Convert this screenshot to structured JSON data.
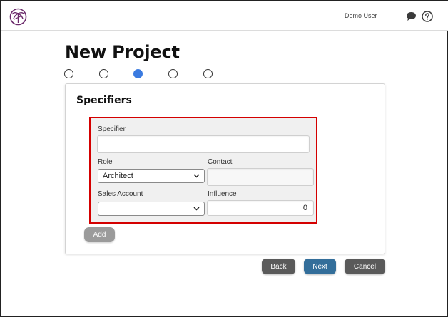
{
  "header": {
    "user_name": "Demo User",
    "icons": [
      "palm-logo-icon",
      "chat-icon",
      "help-icon"
    ]
  },
  "page": {
    "title": "New Project",
    "steps": [
      {
        "state": "incomplete"
      },
      {
        "state": "incomplete"
      },
      {
        "state": "current"
      },
      {
        "state": "incomplete"
      },
      {
        "state": "incomplete"
      }
    ]
  },
  "section": {
    "title": "Specifiers",
    "fields": {
      "specifier_label": "Specifier",
      "specifier_value": "",
      "role_label": "Role",
      "role_value": "Architect",
      "contact_label": "Contact",
      "contact_value": "",
      "sales_account_label": "Sales Account",
      "sales_account_value": "",
      "influence_label": "Influence",
      "influence_value": "0"
    },
    "add_label": "Add"
  },
  "actions": {
    "back_label": "Back",
    "next_label": "Next",
    "cancel_label": "Cancel"
  },
  "colors": {
    "accent_blue": "#3b7be0",
    "next_button": "#336e9a",
    "dark_button": "#5a5a5a",
    "add_button": "#9b9b9b",
    "highlight_border": "#d40000",
    "logo": "#6b2a6b"
  }
}
